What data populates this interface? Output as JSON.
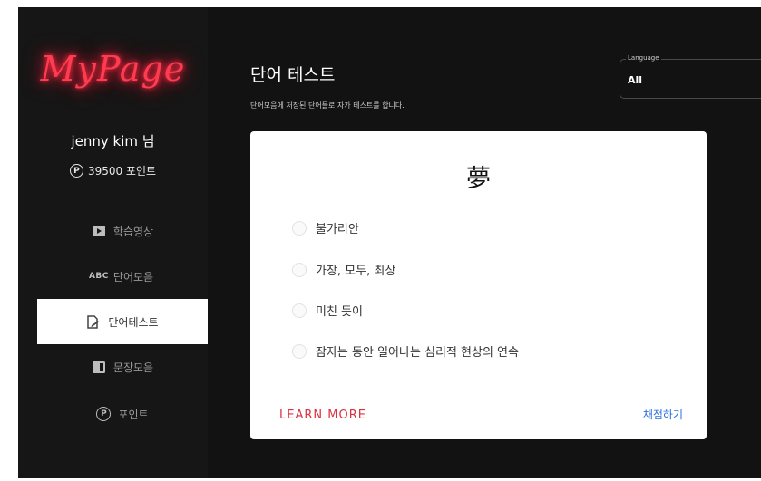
{
  "sidebar": {
    "logo": "MyPage",
    "username": "jenny kim 님",
    "points_badge": "P",
    "points": "39500 포인트",
    "items": [
      {
        "label": "학습영상",
        "icon": "video-icon",
        "active": false
      },
      {
        "label": "단어모음",
        "icon": "abc-icon",
        "icon_text": "ABC",
        "active": false
      },
      {
        "label": "단어테스트",
        "icon": "test-document-icon",
        "active": true
      },
      {
        "label": "문장모음",
        "icon": "book-icon",
        "active": false
      },
      {
        "label": "포인트",
        "icon": "point-icon",
        "icon_text": "P",
        "active": false
      }
    ]
  },
  "main": {
    "title": "단어 테스트",
    "subtitle": "단어모음에 저장된 단어들로 자가 테스트를 합니다.",
    "language": {
      "label": "Language",
      "value": "All"
    }
  },
  "quiz": {
    "word": "夢",
    "options": [
      "불가리안",
      "가장, 모두, 최상",
      "미친 듯이",
      "잠자는 동안 일어나는 심리적 현상의 연속"
    ],
    "learn_more": "LEARN MORE",
    "grade": "채점하기"
  },
  "colors": {
    "background": "#121212",
    "logo_neon": "#ff3b50",
    "learn_more": "#d9323f",
    "grade_link": "#2b6de0"
  }
}
